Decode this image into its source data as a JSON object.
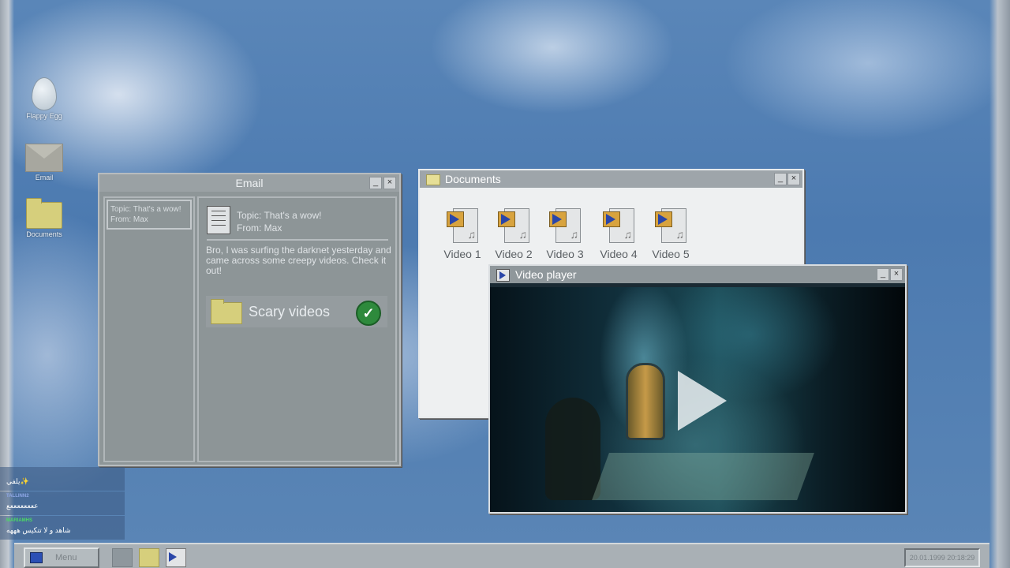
{
  "desktop": {
    "icons": [
      {
        "label": "Flappy Egg",
        "icon": "egg-icon"
      },
      {
        "label": "Email",
        "icon": "envelope-icon"
      },
      {
        "label": "Documents",
        "icon": "folder-icon"
      }
    ]
  },
  "email_window": {
    "title": "Email",
    "minimize": "_",
    "close": "×",
    "list": [
      {
        "topic": "Topic: That's a wow!",
        "from": "From: Max"
      }
    ],
    "message": {
      "topic": "Topic: That's a wow!",
      "from": "From: Max",
      "body": "Bro, I was surfing the darknet yesterday and came across some creepy videos. Check it out!",
      "attachment": "Scary videos",
      "attachment_status": "✓"
    }
  },
  "documents_window": {
    "title": "Documents",
    "minimize": "_",
    "close": "×",
    "files": [
      "Video 1",
      "Video 2",
      "Video 3",
      "Video 4",
      "Video 5"
    ]
  },
  "video_player": {
    "title": "Video player",
    "minimize": "_",
    "close": "×"
  },
  "chat": [
    {
      "user": "",
      "user_color": "#c0392b",
      "message": "يلفي✨"
    },
    {
      "user": "TALLINN2",
      "user_color": "#8fa8e8",
      "message": "ععععععععع"
    },
    {
      "user": "MARIAMHS",
      "user_color": "#4cd964",
      "message": "شاهد و لا تتكيس هههه"
    }
  ],
  "taskbar": {
    "menu_label": "Menu",
    "clock": "20.01.1999 20:18:29"
  }
}
